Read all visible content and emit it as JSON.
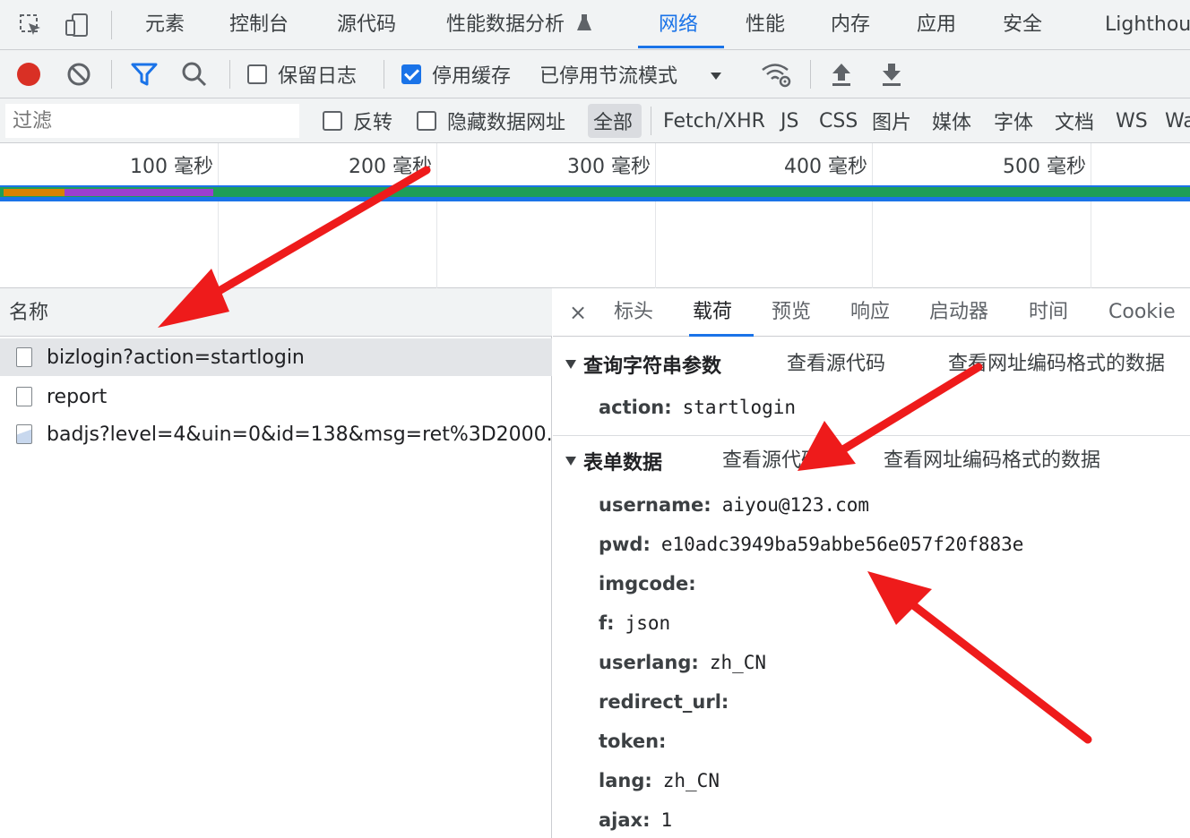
{
  "main_tabs": [
    {
      "label": "元素"
    },
    {
      "label": "控制台"
    },
    {
      "label": "源代码"
    },
    {
      "label": "性能数据分析"
    },
    {
      "label": "网络"
    },
    {
      "label": "性能"
    },
    {
      "label": "内存"
    },
    {
      "label": "应用"
    },
    {
      "label": "安全"
    },
    {
      "label": "Lighthou"
    }
  ],
  "active_main_tab": "网络",
  "toolbar": {
    "preserve_log_label": "保留日志",
    "disable_cache_label": "停用缓存",
    "throttling_value": "已停用节流模式",
    "preserve_log_checked": false,
    "disable_cache_checked": true
  },
  "filter": {
    "placeholder": "过滤",
    "invert_label": "反转",
    "hide_data_urls_label": "隐藏数据网址",
    "types": [
      "全部",
      "Fetch/XHR",
      "JS",
      "CSS",
      "图片",
      "媒体",
      "字体",
      "文档",
      "WS",
      "Wa"
    ]
  },
  "timeline": {
    "ticks": [
      "100 毫秒",
      "200 毫秒",
      "300 毫秒",
      "400 毫秒",
      "500 毫秒"
    ]
  },
  "requests": {
    "column_header": "名称",
    "rows": [
      {
        "name": "bizlogin?action=startlogin",
        "selected": true,
        "icon": "document-icon"
      },
      {
        "name": "report",
        "selected": false,
        "icon": "document-icon"
      },
      {
        "name": "badjs?level=4&uin=0&id=138&msg=ret%3D2000...",
        "selected": false,
        "icon": "image-icon"
      }
    ]
  },
  "details": {
    "close_glyph": "×",
    "tabs": [
      {
        "label": "标头"
      },
      {
        "label": "载荷"
      },
      {
        "label": "预览"
      },
      {
        "label": "响应"
      },
      {
        "label": "启动器"
      },
      {
        "label": "时间"
      },
      {
        "label": "Cookie"
      }
    ],
    "active_tab": "载荷",
    "query_section": {
      "title": "查询字符串参数",
      "view_source": "查看源代码",
      "view_url_encoded": "查看网址编码格式的数据",
      "params": [
        {
          "key": "action:",
          "value": "startlogin"
        }
      ]
    },
    "form_section": {
      "title": "表单数据",
      "view_source": "查看源代码",
      "view_url_encoded": "查看网址编码格式的数据",
      "params": [
        {
          "key": "username:",
          "value": "aiyou@123.com"
        },
        {
          "key": "pwd:",
          "value": "e10adc3949ba59abbe56e057f20f883e"
        },
        {
          "key": "imgcode:",
          "value": ""
        },
        {
          "key": "f:",
          "value": "json"
        },
        {
          "key": "userlang:",
          "value": "zh_CN"
        },
        {
          "key": "redirect_url:",
          "value": ""
        },
        {
          "key": "token:",
          "value": ""
        },
        {
          "key": "lang:",
          "value": "zh_CN"
        },
        {
          "key": "ajax:",
          "value": "1"
        }
      ]
    }
  },
  "colors": {
    "accent": "#1a73e8",
    "record": "#d93025",
    "annotation_arrow": "#ee1b1b",
    "timeline_orange": "#d98200",
    "timeline_purple": "#9b3fcf",
    "timeline_green": "#1e9e58",
    "timeline_blue": "#1a73e8"
  }
}
